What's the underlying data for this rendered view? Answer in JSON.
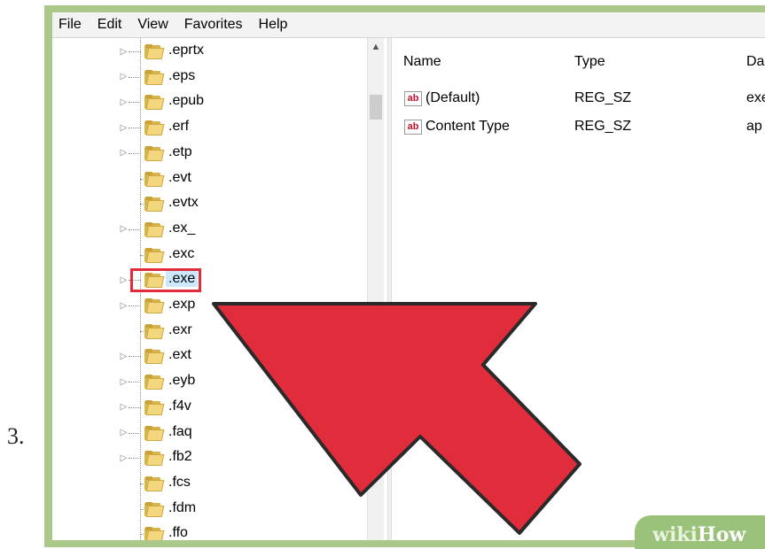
{
  "step_number": "3.",
  "menu": [
    "File",
    "Edit",
    "View",
    "Favorites",
    "Help"
  ],
  "tree": {
    "items": [
      {
        "label": ".eprtx",
        "expandable": true
      },
      {
        "label": ".eps",
        "expandable": true
      },
      {
        "label": ".epub",
        "expandable": true
      },
      {
        "label": ".erf",
        "expandable": true
      },
      {
        "label": ".etp",
        "expandable": true
      },
      {
        "label": ".evt",
        "expandable": false
      },
      {
        "label": ".evtx",
        "expandable": false
      },
      {
        "label": ".ex_",
        "expandable": true
      },
      {
        "label": ".exc",
        "expandable": false
      },
      {
        "label": ".exe",
        "expandable": true,
        "selected": true,
        "highlighted": true
      },
      {
        "label": ".exp",
        "expandable": true
      },
      {
        "label": ".exr",
        "expandable": false
      },
      {
        "label": ".ext",
        "expandable": true
      },
      {
        "label": ".eyb",
        "expandable": true
      },
      {
        "label": ".f4v",
        "expandable": true
      },
      {
        "label": ".faq",
        "expandable": true
      },
      {
        "label": ".fb2",
        "expandable": true
      },
      {
        "label": ".fcs",
        "expandable": false
      },
      {
        "label": ".fdm",
        "expandable": false
      },
      {
        "label": ".ffo",
        "expandable": false
      }
    ],
    "expander_icon": "collapsed-triangle-icon",
    "item_icon": "folder-icon"
  },
  "values_pane": {
    "columns": [
      "Name",
      "Type",
      "Da"
    ],
    "rows": [
      {
        "name": "(Default)",
        "type": "REG_SZ",
        "data": "exe"
      },
      {
        "name": "Content Type",
        "type": "REG_SZ",
        "data": "ap"
      }
    ],
    "row_icon": "reg-string-icon",
    "row_icon_text": "ab"
  },
  "annotation": {
    "arrow_color": "#e12c3c",
    "highlight_color": "#e12c3c"
  },
  "watermark": {
    "wiki": "wiki",
    "how": "How"
  },
  "colors": {
    "frame": "#a9c889",
    "selection": "#cce8ff",
    "folder": "#f2d77e"
  }
}
